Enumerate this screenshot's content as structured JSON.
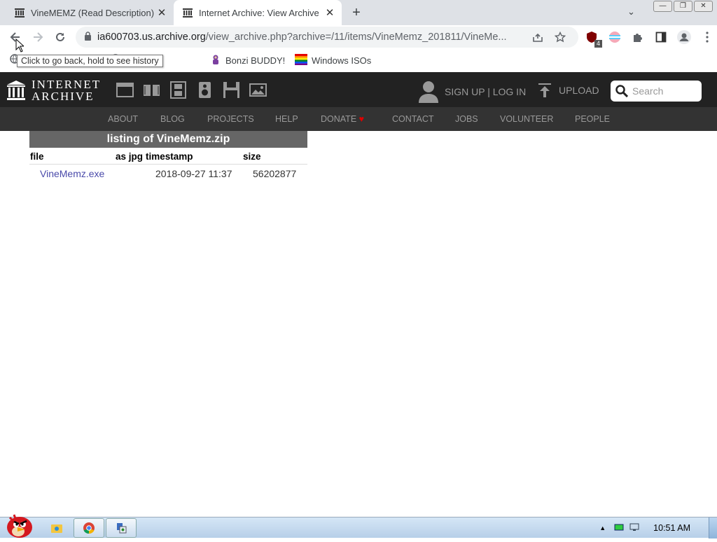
{
  "tabs": [
    {
      "title": "VineMEMZ (Read Description)",
      "close": "✕"
    },
    {
      "title": "Internet Archive: View Archive",
      "close": "✕"
    }
  ],
  "new_tab": "+",
  "tab_search": "⌄",
  "window_controls": [
    "—",
    "❐",
    "✕"
  ],
  "toolbar": {
    "url_host": "ia600703.us.archive.org",
    "url_path": "/view_archive.php?archive=/11/items/VineMemz_201811/VineMe...",
    "ext_badge": "4"
  },
  "tooltip": "Click to go back, hold to see history",
  "bookmarks": [
    {
      "label": "tabase",
      "icon": "globe-icon"
    },
    {
      "label": "Bonzi BUDDY!",
      "icon": "bonzi-icon"
    },
    {
      "label": "Windows ISOs",
      "icon": "windows-flag-icon"
    }
  ],
  "ia": {
    "logo_line1": "INTERNET",
    "logo_line2": "ARCHIVE",
    "signup": "SIGN UP | LOG IN",
    "upload": "UPLOAD",
    "search_placeholder": "Search",
    "nav": [
      "ABOUT",
      "BLOG",
      "PROJECTS",
      "HELP",
      "DONATE",
      "CONTACT",
      "JOBS",
      "VOLUNTEER",
      "PEOPLE"
    ]
  },
  "listing": {
    "title": "listing of VineMemz.zip",
    "headers": [
      "file",
      "as jpg",
      "timestamp",
      "size"
    ],
    "rows": [
      {
        "file": "VineMemz.exe",
        "as_jpg": "",
        "timestamp": "2018-09-27 11:37",
        "size": "56202877"
      }
    ]
  },
  "taskbar": {
    "time": "10:51 AM"
  },
  "colors": {
    "ia_header": "#222222",
    "ia_nav": "#333333",
    "listing_head": "#666666",
    "link": "#4a4aaa",
    "donate_heart": "#e00000"
  }
}
